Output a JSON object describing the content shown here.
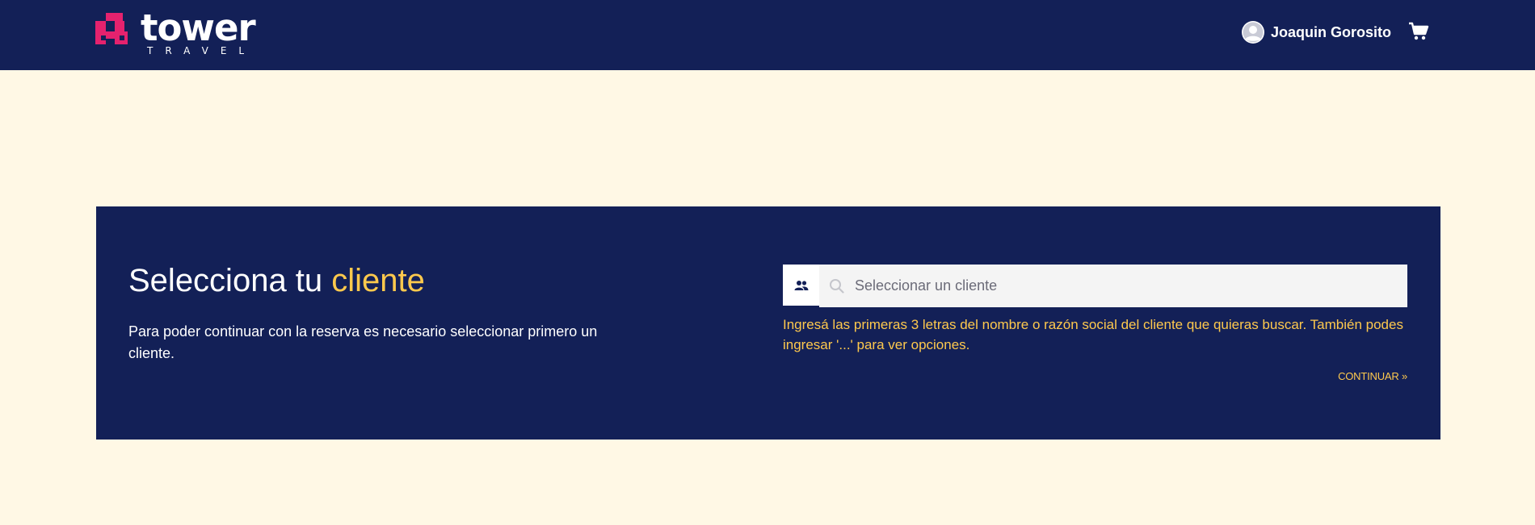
{
  "header": {
    "brand": {
      "word": "tower",
      "sub": "TRAVEL"
    },
    "user": {
      "name": "Joaquin Gorosito",
      "avatar_icon": "user-circle-icon"
    },
    "cart_icon": "shopping-cart-icon",
    "background": "#132057"
  },
  "client_select": {
    "title_prefix": "Selecciona tu",
    "title_accent": "cliente",
    "description": "Para poder continuar con la reserva es necesario seleccionar primero un cliente.",
    "search": {
      "prefix_icon": "users-icon",
      "search_icon": "search-icon",
      "placeholder": "Seleccionar un cliente",
      "value": ""
    },
    "hint": "Ingresá las primeras 3 letras del nombre o razón social del cliente que quieras buscar. También podes ingresar '...' para ver opciones.",
    "continue_label": "CONTINUAR »"
  },
  "colors": {
    "navy": "#132057",
    "accent": "#ffc94d",
    "brand_pink": "#e5226e",
    "page_bg": "#fff8e5"
  }
}
